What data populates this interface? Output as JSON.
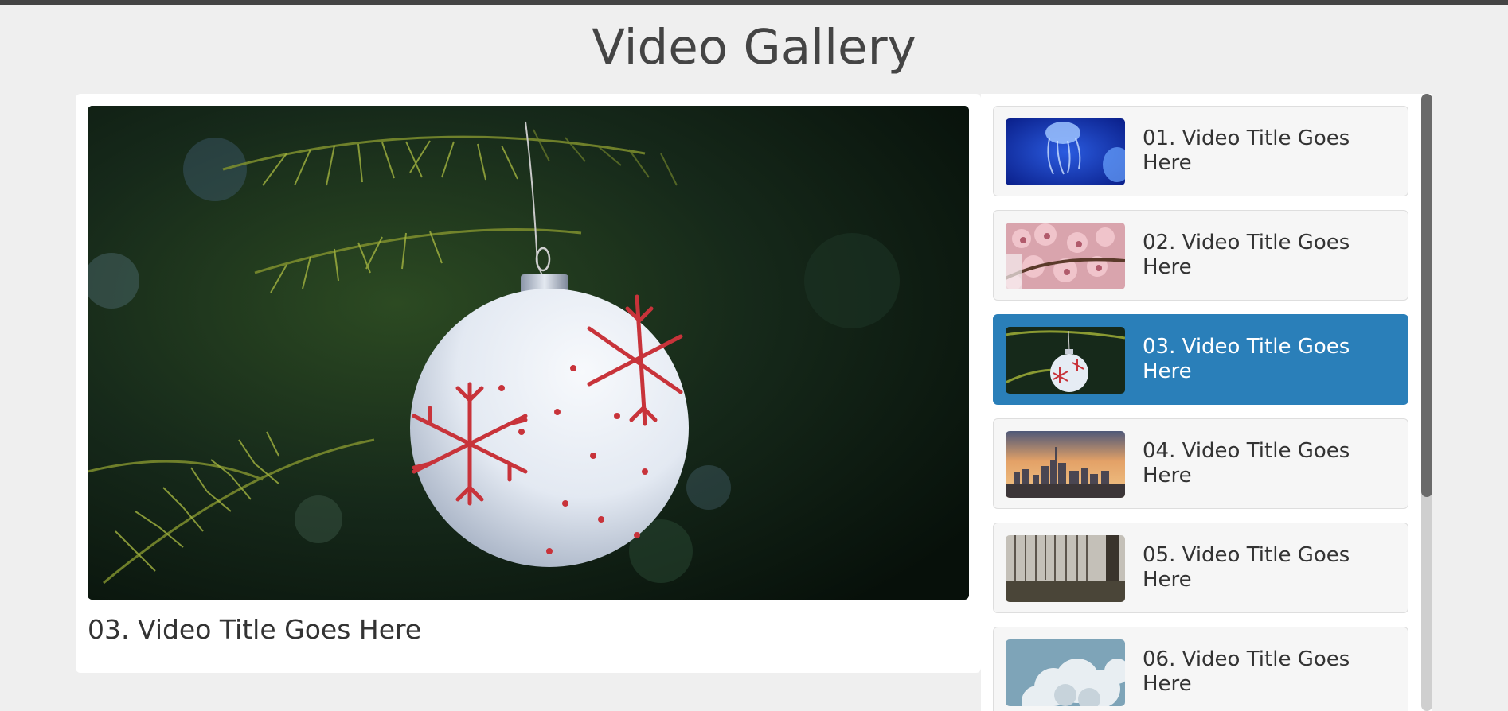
{
  "page": {
    "title": "Video Gallery"
  },
  "player": {
    "current_title": "03. Video Title Goes Here",
    "current_index": 3
  },
  "playlist": {
    "items": [
      {
        "label": "01. Video Title Goes Here",
        "thumbnail": "jellyfish"
      },
      {
        "label": "02. Video Title Goes Here",
        "thumbnail": "cherry-blossoms"
      },
      {
        "label": "03. Video Title Goes Here",
        "thumbnail": "christmas-ornament",
        "active": true
      },
      {
        "label": "04. Video Title Goes Here",
        "thumbnail": "city-sunset"
      },
      {
        "label": "05. Video Title Goes Here",
        "thumbnail": "misty-forest"
      },
      {
        "label": "06. Video Title Goes Here",
        "thumbnail": "clouds"
      }
    ]
  },
  "colors": {
    "accent": "#2a7fb9",
    "background": "#efefef",
    "top_bar": "#444444"
  }
}
